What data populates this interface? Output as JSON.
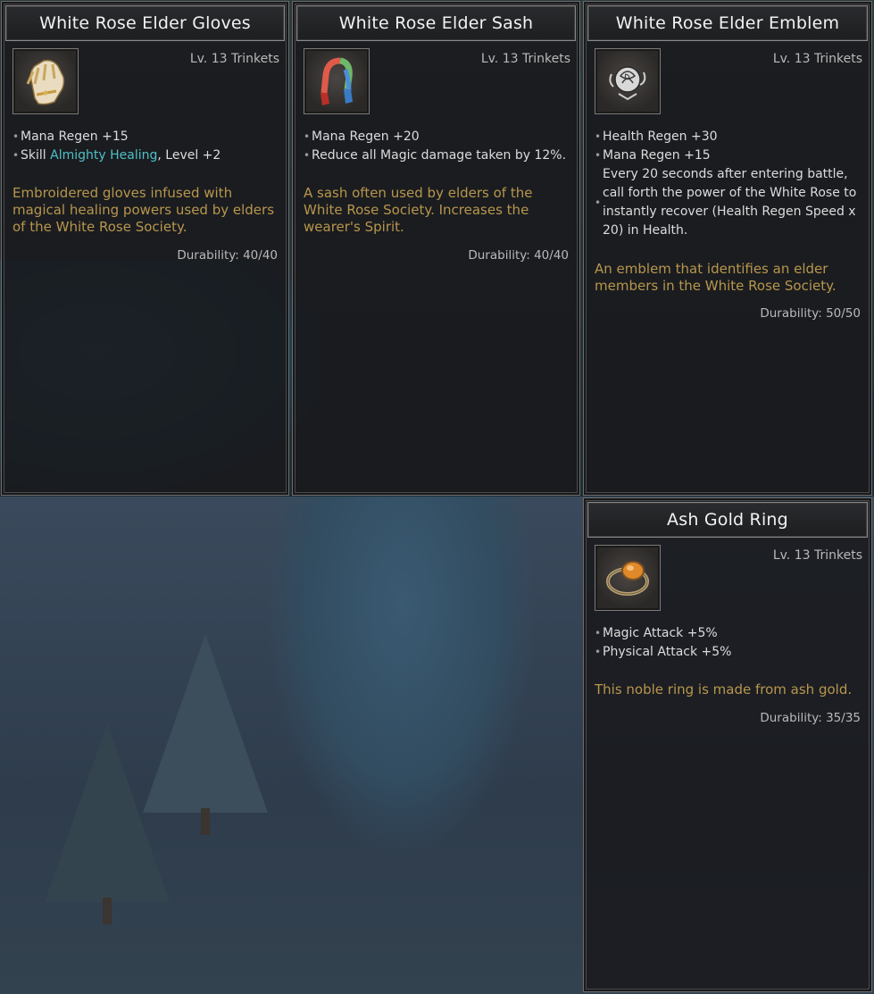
{
  "panels": [
    {
      "title": "White Rose Elder Gloves",
      "level": "Lv. 13 Trinkets",
      "icon": "gloves-icon",
      "stats": [
        {
          "text": "Mana Regen +15"
        },
        {
          "pre": "Skill ",
          "highlight": "Almighty Healing",
          "post": ", Level +2"
        }
      ],
      "description": "Embroidered gloves infused with magical healing powers used by elders of the White Rose Society.",
      "durability": "Durability: 40/40"
    },
    {
      "title": "White Rose Elder Sash",
      "level": "Lv. 13 Trinkets",
      "icon": "sash-icon",
      "stats": [
        {
          "text": "Mana Regen +20"
        },
        {
          "text": "Reduce all Magic damage taken by 12%."
        }
      ],
      "description": "A sash often used by elders of the White Rose Society. Increases the wearer's Spirit.",
      "durability": "Durability: 40/40"
    },
    {
      "title": "White Rose Elder Emblem",
      "level": "Lv. 13 Trinkets",
      "icon": "rose-emblem-icon",
      "stats": [
        {
          "text": "Health Regen +30"
        },
        {
          "text": "Mana Regen +15"
        },
        {
          "text": "Every 20 seconds after entering battle, call forth the power of the White Rose to instantly recover (Health Regen Speed x 20) in Health."
        }
      ],
      "description": "An emblem that identifies an elder members in the White Rose Society.",
      "durability": "Durability: 50/50"
    },
    {
      "title": "Ash Gold Ring",
      "level": "Lv. 13 Trinkets",
      "icon": "ring-icon",
      "stats": [
        {
          "text": "Magic Attack +5%"
        },
        {
          "text": "Physical Attack +5%"
        }
      ],
      "description": "This noble ring is made from ash gold.",
      "durability": "Durability: 35/35"
    }
  ],
  "colors": {
    "highlight": "#4fc0c7",
    "description": "#b8964c",
    "stat_text": "#dcdcdc"
  }
}
